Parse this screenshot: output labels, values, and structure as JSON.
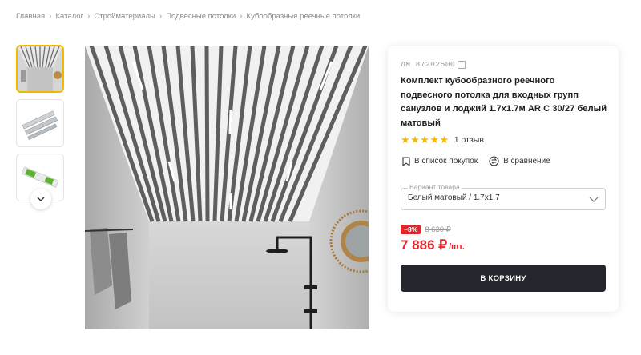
{
  "breadcrumb": [
    "Главная",
    "Каталог",
    "Стройматериалы",
    "Подвесные потолки",
    "Кубообразные реечные потолки"
  ],
  "product": {
    "sku": "ЛМ 87202500",
    "title": "Комплект кубообразного реечного подвесного потолка для входных групп санузлов и лоджий 1.7x1.7м AR C 30/27 белый матовый",
    "rating": 5,
    "stars": "★★★★★",
    "reviews": "1 отзыв",
    "shopping_list_label": "В список покупок",
    "compare_label": "В сравнение",
    "variant_label": "Вариант товара",
    "variant_value": "Белый матовый / 1.7x1.7",
    "discount": "−8%",
    "old_price": "8 630 ₽",
    "price": "7 886 ₽",
    "price_unit": "/шт.",
    "cart_button": "В КОРЗИНУ"
  },
  "gallery": {
    "thumbnails": [
      "ceiling-interior",
      "slat-profiles",
      "packaged-kit"
    ]
  },
  "colors": {
    "accent": "#f2b800",
    "price": "#e1272e",
    "button": "#23272d",
    "stars": "#f5b900"
  }
}
